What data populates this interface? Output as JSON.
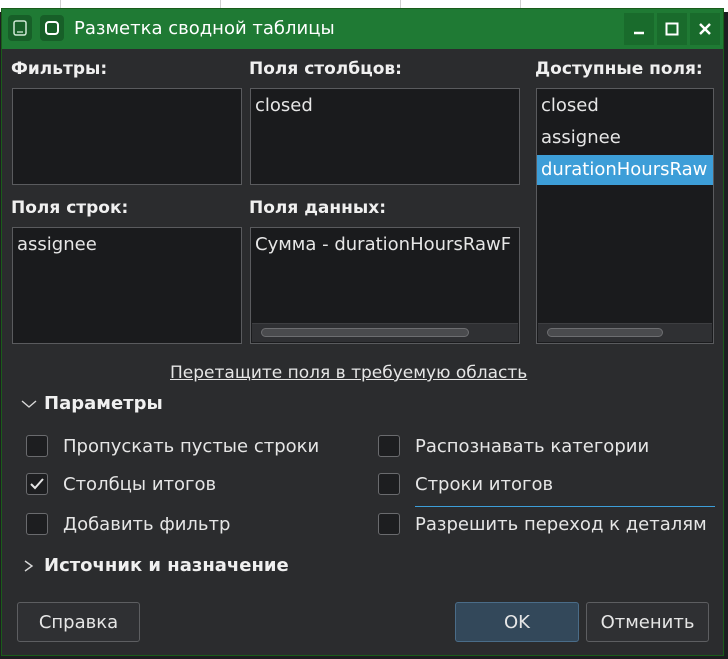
{
  "window": {
    "title": "Разметка сводной таблицы",
    "title_icon": "dialog-icon",
    "app_icon": "document-icon",
    "controls": [
      "minimize-icon",
      "maximize-icon",
      "close-icon"
    ]
  },
  "areas": {
    "filters": {
      "label": "Фильтры:",
      "items": []
    },
    "column_fields": {
      "label": "Поля столбцов:",
      "items": [
        "closed"
      ]
    },
    "available_fields": {
      "label": "Доступные поля:",
      "items": [
        "closed",
        "assignee",
        "durationHoursRaw"
      ],
      "selected_index": 2
    },
    "row_fields": {
      "label": "Поля строк:",
      "items": [
        "assignee"
      ]
    },
    "data_fields": {
      "label": "Поля данных:",
      "items": [
        "Сумма - durationHoursRawF"
      ]
    }
  },
  "drag_hint": "Перетащите поля в требуемую область",
  "options": {
    "header": "Параметры",
    "items": [
      {
        "label": "Пропускать пустые строки",
        "checked": false
      },
      {
        "label": "Столбцы итогов",
        "checked": true
      },
      {
        "label": "Добавить фильтр",
        "checked": false
      },
      {
        "label": "Распознавать категории",
        "checked": false
      },
      {
        "label": "Строки итогов",
        "checked": false
      },
      {
        "label": "Разрешить переход к деталям",
        "checked": false
      }
    ]
  },
  "source": {
    "header": "Источник и назначение"
  },
  "buttons": {
    "help": "Справка",
    "ok": "OK",
    "cancel": "Отменить"
  },
  "colors": {
    "titlebar": "#1f7a34",
    "selection": "#3d9ed8",
    "dialog_bg": "#2b2c2e"
  }
}
